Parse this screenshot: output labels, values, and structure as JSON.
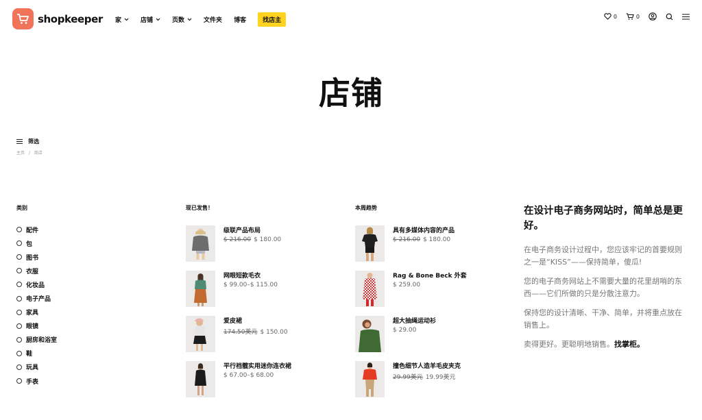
{
  "brand": {
    "name": "shopkeeper",
    "logo_color": "#f0735a"
  },
  "nav": {
    "items": [
      {
        "label": "家",
        "dropdown": true
      },
      {
        "label": "店铺",
        "dropdown": true
      },
      {
        "label": "页数",
        "dropdown": true
      },
      {
        "label": "文件夹",
        "dropdown": false
      },
      {
        "label": "博客",
        "dropdown": false
      }
    ],
    "badge": {
      "label": "找店主",
      "color": "#ffd31f"
    }
  },
  "tools": {
    "wishlist_count": "0",
    "cart_count": "0"
  },
  "page_title": "店铺",
  "filter": {
    "label": "筛选"
  },
  "breadcrumb": {
    "home": "主页",
    "sep": "/",
    "current": "商店"
  },
  "categories": {
    "title": "类别",
    "items": [
      "配件",
      "包",
      "图书",
      "衣服",
      "化妆品",
      "电子产品",
      "家具",
      "眼镜",
      "厨房和浴室",
      "鞋",
      "玩具",
      "手表"
    ]
  },
  "onsale": {
    "title": "现已发售！",
    "products": [
      {
        "name": "级联产品布局",
        "old_price": "$ 216.00",
        "price": "$ 180.00"
      },
      {
        "name": "网眼短款毛衣",
        "old_price": "",
        "price": "$ 99.00–$ 115.00"
      },
      {
        "name": "爱皮裙",
        "old_price": "174.50美元",
        "price": "$ 150.00"
      },
      {
        "name": "平行裆髋实用迷你连衣裙",
        "old_price": "",
        "price": "$ 67.00–$ 68.00"
      }
    ]
  },
  "trending": {
    "title": "本周趋势",
    "products": [
      {
        "name": "具有多媒体内容的产品",
        "old_price": "$ 216.00",
        "price": "$ 180.00"
      },
      {
        "name": "Rag & Bone Beck 外套",
        "old_price": "",
        "price": "$ 259.00"
      },
      {
        "name": "超大抽绳运动衫",
        "old_price": "",
        "price": "$ 29.00"
      },
      {
        "name": "撞色细节人造羊毛皮夹克",
        "old_price": "29.99美元",
        "price": "19.99美元"
      }
    ]
  },
  "promo": {
    "heading": "在设计电子商务网站时，简单总是更好。",
    "p1": "在电子商务设计过程中，您应该牢记的首要规则之一是“KISS”——保持简单，傻瓜!",
    "p2": "您的电子商务网站上不需要大量的花里胡哨的东西——它们所做的只是分散注意力。",
    "p3": "保持您的设计清晰、干净、简单，并将重点放在销售上。",
    "p4": "卖得更好。更聪明地销售。",
    "p4_bold": "找掌柜。"
  }
}
